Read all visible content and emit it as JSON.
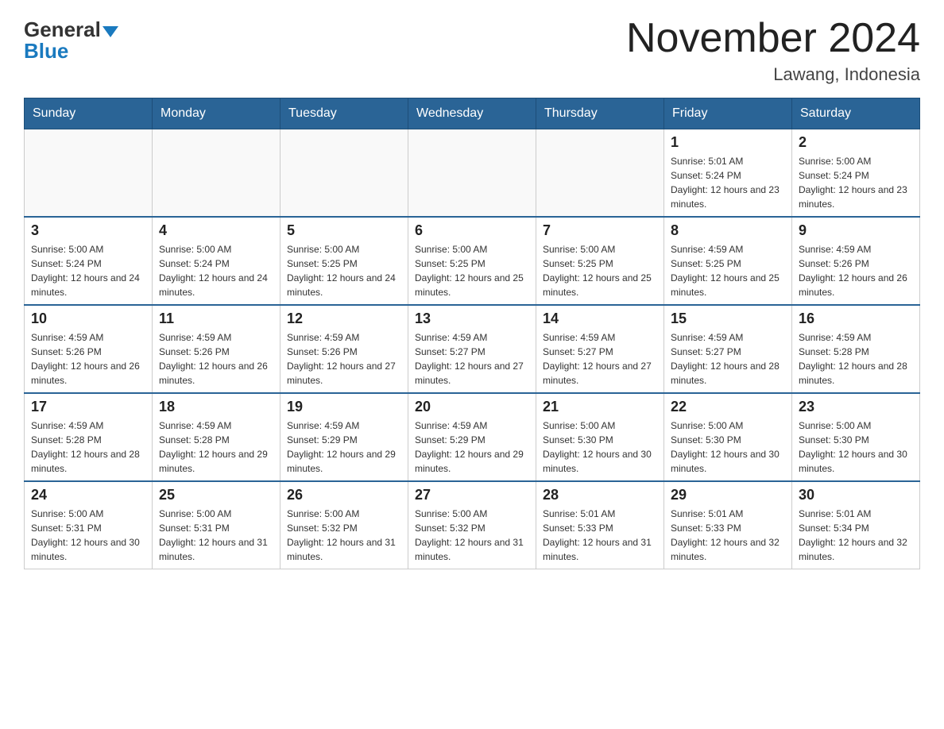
{
  "header": {
    "logo_general": "General",
    "logo_blue": "Blue",
    "title": "November 2024",
    "location": "Lawang, Indonesia"
  },
  "days_of_week": [
    "Sunday",
    "Monday",
    "Tuesday",
    "Wednesday",
    "Thursday",
    "Friday",
    "Saturday"
  ],
  "weeks": [
    [
      {
        "day": "",
        "info": ""
      },
      {
        "day": "",
        "info": ""
      },
      {
        "day": "",
        "info": ""
      },
      {
        "day": "",
        "info": ""
      },
      {
        "day": "",
        "info": ""
      },
      {
        "day": "1",
        "info": "Sunrise: 5:01 AM\nSunset: 5:24 PM\nDaylight: 12 hours and 23 minutes."
      },
      {
        "day": "2",
        "info": "Sunrise: 5:00 AM\nSunset: 5:24 PM\nDaylight: 12 hours and 23 minutes."
      }
    ],
    [
      {
        "day": "3",
        "info": "Sunrise: 5:00 AM\nSunset: 5:24 PM\nDaylight: 12 hours and 24 minutes."
      },
      {
        "day": "4",
        "info": "Sunrise: 5:00 AM\nSunset: 5:24 PM\nDaylight: 12 hours and 24 minutes."
      },
      {
        "day": "5",
        "info": "Sunrise: 5:00 AM\nSunset: 5:25 PM\nDaylight: 12 hours and 24 minutes."
      },
      {
        "day": "6",
        "info": "Sunrise: 5:00 AM\nSunset: 5:25 PM\nDaylight: 12 hours and 25 minutes."
      },
      {
        "day": "7",
        "info": "Sunrise: 5:00 AM\nSunset: 5:25 PM\nDaylight: 12 hours and 25 minutes."
      },
      {
        "day": "8",
        "info": "Sunrise: 4:59 AM\nSunset: 5:25 PM\nDaylight: 12 hours and 25 minutes."
      },
      {
        "day": "9",
        "info": "Sunrise: 4:59 AM\nSunset: 5:26 PM\nDaylight: 12 hours and 26 minutes."
      }
    ],
    [
      {
        "day": "10",
        "info": "Sunrise: 4:59 AM\nSunset: 5:26 PM\nDaylight: 12 hours and 26 minutes."
      },
      {
        "day": "11",
        "info": "Sunrise: 4:59 AM\nSunset: 5:26 PM\nDaylight: 12 hours and 26 minutes."
      },
      {
        "day": "12",
        "info": "Sunrise: 4:59 AM\nSunset: 5:26 PM\nDaylight: 12 hours and 27 minutes."
      },
      {
        "day": "13",
        "info": "Sunrise: 4:59 AM\nSunset: 5:27 PM\nDaylight: 12 hours and 27 minutes."
      },
      {
        "day": "14",
        "info": "Sunrise: 4:59 AM\nSunset: 5:27 PM\nDaylight: 12 hours and 27 minutes."
      },
      {
        "day": "15",
        "info": "Sunrise: 4:59 AM\nSunset: 5:27 PM\nDaylight: 12 hours and 28 minutes."
      },
      {
        "day": "16",
        "info": "Sunrise: 4:59 AM\nSunset: 5:28 PM\nDaylight: 12 hours and 28 minutes."
      }
    ],
    [
      {
        "day": "17",
        "info": "Sunrise: 4:59 AM\nSunset: 5:28 PM\nDaylight: 12 hours and 28 minutes."
      },
      {
        "day": "18",
        "info": "Sunrise: 4:59 AM\nSunset: 5:28 PM\nDaylight: 12 hours and 29 minutes."
      },
      {
        "day": "19",
        "info": "Sunrise: 4:59 AM\nSunset: 5:29 PM\nDaylight: 12 hours and 29 minutes."
      },
      {
        "day": "20",
        "info": "Sunrise: 4:59 AM\nSunset: 5:29 PM\nDaylight: 12 hours and 29 minutes."
      },
      {
        "day": "21",
        "info": "Sunrise: 5:00 AM\nSunset: 5:30 PM\nDaylight: 12 hours and 30 minutes."
      },
      {
        "day": "22",
        "info": "Sunrise: 5:00 AM\nSunset: 5:30 PM\nDaylight: 12 hours and 30 minutes."
      },
      {
        "day": "23",
        "info": "Sunrise: 5:00 AM\nSunset: 5:30 PM\nDaylight: 12 hours and 30 minutes."
      }
    ],
    [
      {
        "day": "24",
        "info": "Sunrise: 5:00 AM\nSunset: 5:31 PM\nDaylight: 12 hours and 30 minutes."
      },
      {
        "day": "25",
        "info": "Sunrise: 5:00 AM\nSunset: 5:31 PM\nDaylight: 12 hours and 31 minutes."
      },
      {
        "day": "26",
        "info": "Sunrise: 5:00 AM\nSunset: 5:32 PM\nDaylight: 12 hours and 31 minutes."
      },
      {
        "day": "27",
        "info": "Sunrise: 5:00 AM\nSunset: 5:32 PM\nDaylight: 12 hours and 31 minutes."
      },
      {
        "day": "28",
        "info": "Sunrise: 5:01 AM\nSunset: 5:33 PM\nDaylight: 12 hours and 31 minutes."
      },
      {
        "day": "29",
        "info": "Sunrise: 5:01 AM\nSunset: 5:33 PM\nDaylight: 12 hours and 32 minutes."
      },
      {
        "day": "30",
        "info": "Sunrise: 5:01 AM\nSunset: 5:34 PM\nDaylight: 12 hours and 32 minutes."
      }
    ]
  ]
}
